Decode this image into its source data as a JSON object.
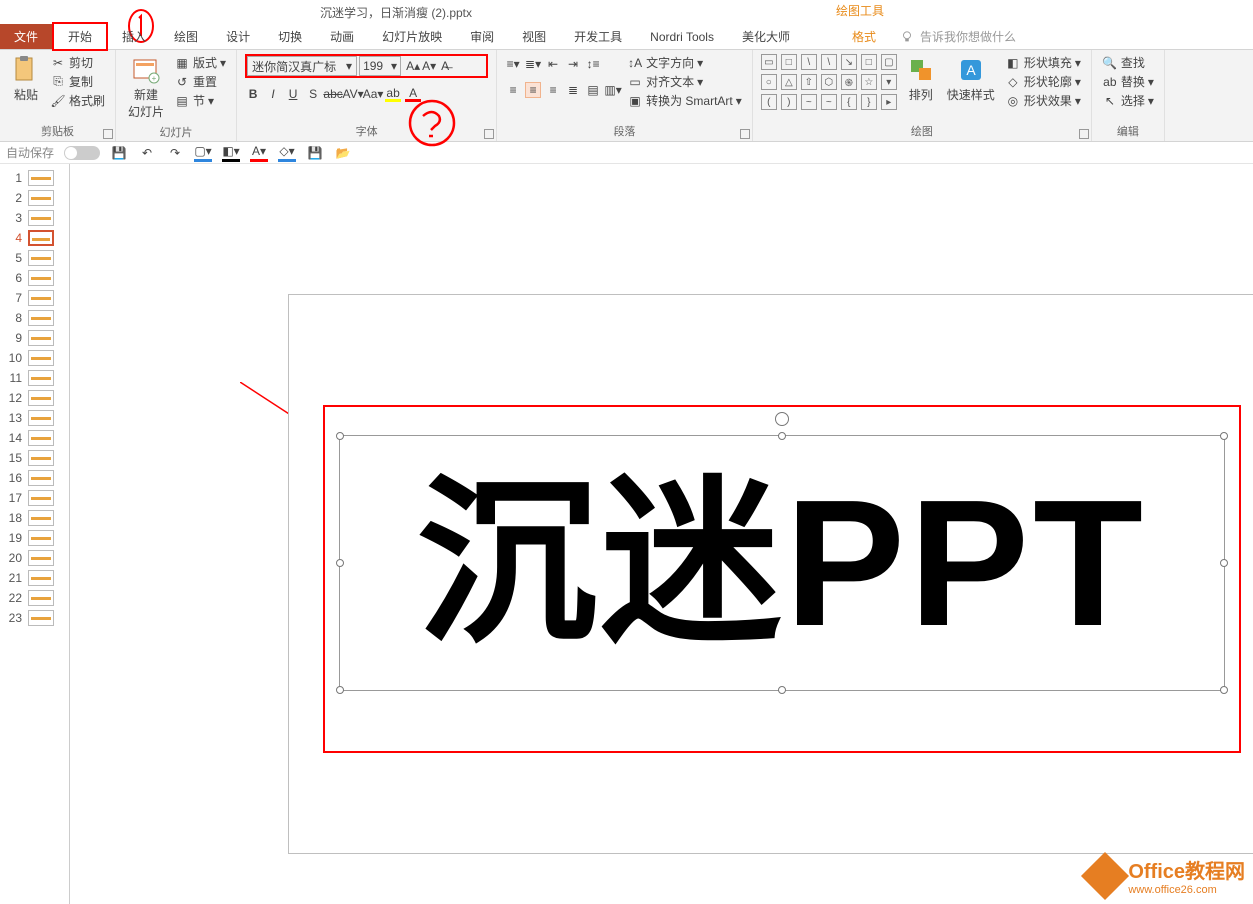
{
  "title": "沉迷学习，日渐消瘦 (2).pptx",
  "contextTool": "绘图工具",
  "tabs": {
    "file": "文件",
    "home": "开始",
    "insert": "插入",
    "draw": "绘图",
    "design": "设计",
    "transitions": "切换",
    "animations": "动画",
    "slideshow": "幻灯片放映",
    "review": "审阅",
    "view": "视图",
    "developer": "开发工具",
    "nordri": "Nordri Tools",
    "beautify": "美化大师",
    "format": "格式"
  },
  "tellme": "告诉我你想做什么",
  "clipboard": {
    "paste": "粘贴",
    "cut": "剪切",
    "copy": "复制",
    "painter": "格式刷",
    "label": "剪贴板"
  },
  "slides": {
    "new": "新建\n幻灯片",
    "layout": "版式",
    "reset": "重置",
    "section": "节",
    "label": "幻灯片"
  },
  "font": {
    "name": "迷你简汉真广标",
    "size": "199",
    "label": "字体"
  },
  "paragraph": {
    "textdir": "文字方向",
    "align": "对齐文本",
    "smartart": "转换为 SmartArt",
    "label": "段落"
  },
  "drawing": {
    "arrange": "排列",
    "quick": "快速样式",
    "fill": "形状填充",
    "outline": "形状轮廓",
    "effects": "形状效果",
    "label": "绘图"
  },
  "editing": {
    "find": "查找",
    "replace": "替换",
    "select": "选择",
    "label": "编辑"
  },
  "qat": {
    "autosave": "自动保存"
  },
  "slideText": "沉迷PPT",
  "watermark": {
    "line1": "Office教程网",
    "line2": "www.office26.com"
  },
  "thumbCount": 23,
  "selectedThumb": 4
}
